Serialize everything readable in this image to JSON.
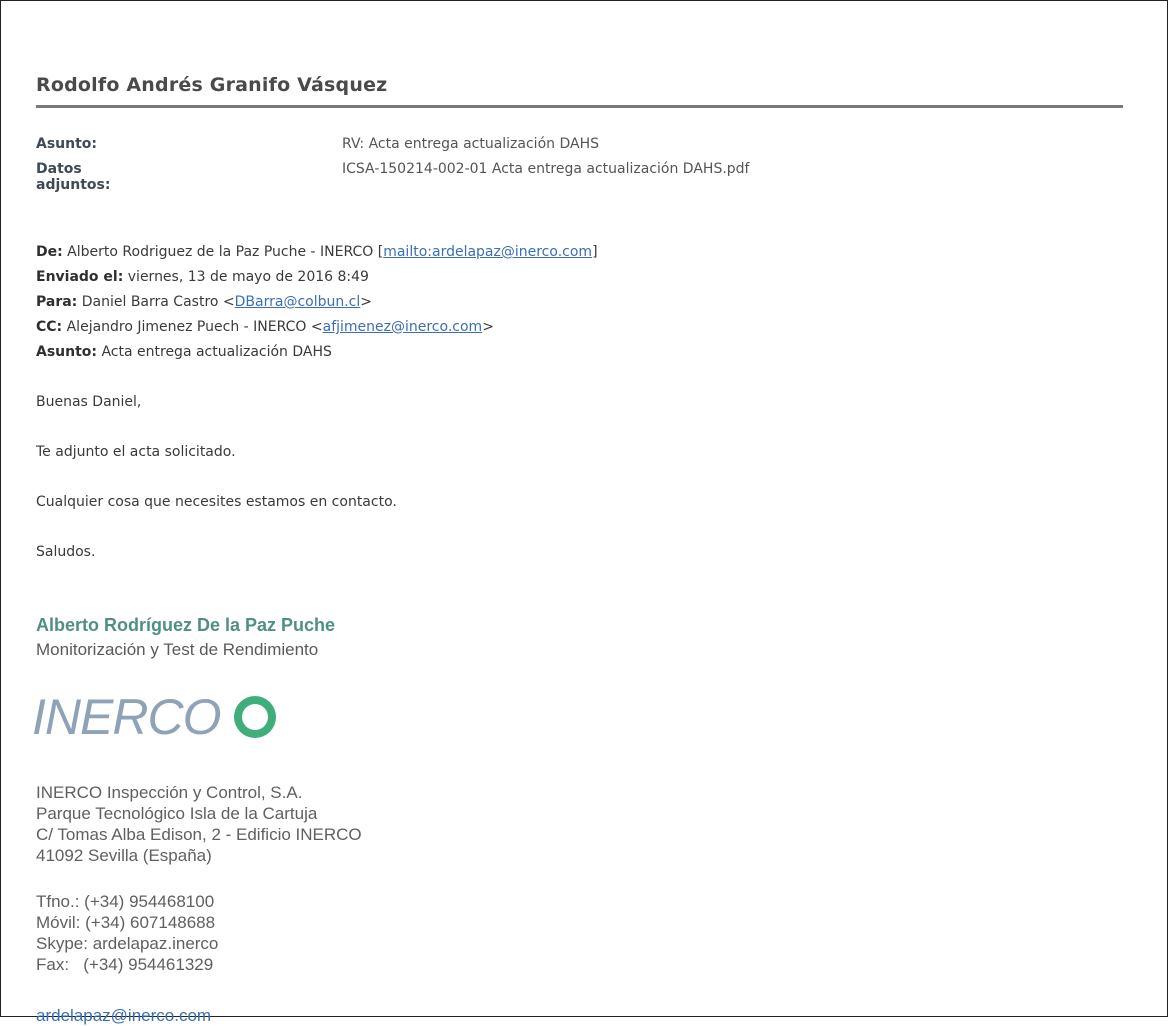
{
  "title": "Rodolfo Andrés Granifo Vásquez",
  "header": {
    "subject_label": "Asunto:",
    "subject_value": "RV: Acta entrega actualización DAHS",
    "attachments_label": "Datos adjuntos:",
    "attachments_value": "ICSA-150214-002-01 Acta entrega actualización DAHS.pdf"
  },
  "forward": {
    "from_label": "De:",
    "from_value": "Alberto Rodriguez de la Paz Puche - INERCO [",
    "from_link": "mailto:ardelapaz@inerco.com",
    "from_close": "]",
    "sent_label": "Enviado el:",
    "sent_value": "viernes, 13 de mayo de 2016 8:49",
    "to_label": "Para:",
    "to_value": "Daniel Barra Castro <",
    "to_link": "DBarra@colbun.cl",
    "to_close": ">",
    "cc_label": "CC:",
    "cc_value": "Alejandro Jimenez Puech - INERCO <",
    "cc_link": "afjimenez@inerco.com",
    "cc_close": ">",
    "subject_label": "Asunto:",
    "subject_value": "Acta entrega actualización DAHS"
  },
  "body": {
    "greeting": "Buenas Daniel,",
    "line1": "Te adjunto el acta solicitado.",
    "line2": "Cualquier cosa que necesites estamos en contacto.",
    "closing": "Saludos."
  },
  "signature": {
    "name": "Alberto Rodríguez De la Paz Puche",
    "role": "Monitorización y Test de Rendimiento",
    "logo_text": "INERCO",
    "company": "INERCO Inspección y Control, S.A.",
    "address1": "Parque Tecnológico Isla de la Cartuja",
    "address2": "C/ Tomas Alba Edison, 2 - Edificio INERCO",
    "address3": "41092 Sevilla (España)",
    "phone": "Tfno.: (+34) 954468100",
    "mobile": "Móvil: (+34) 607148688",
    "skype": "Skype: ardelapaz.inerco",
    "fax": "Fax:   (+34) 954461329",
    "email_partial": "ardelapaz@inerco.com"
  },
  "colors": {
    "signature_name": "#4f8f86",
    "link": "#3b6fb0",
    "logo_text": "#8fa3b8",
    "logo_icon": "#3fae7a"
  }
}
